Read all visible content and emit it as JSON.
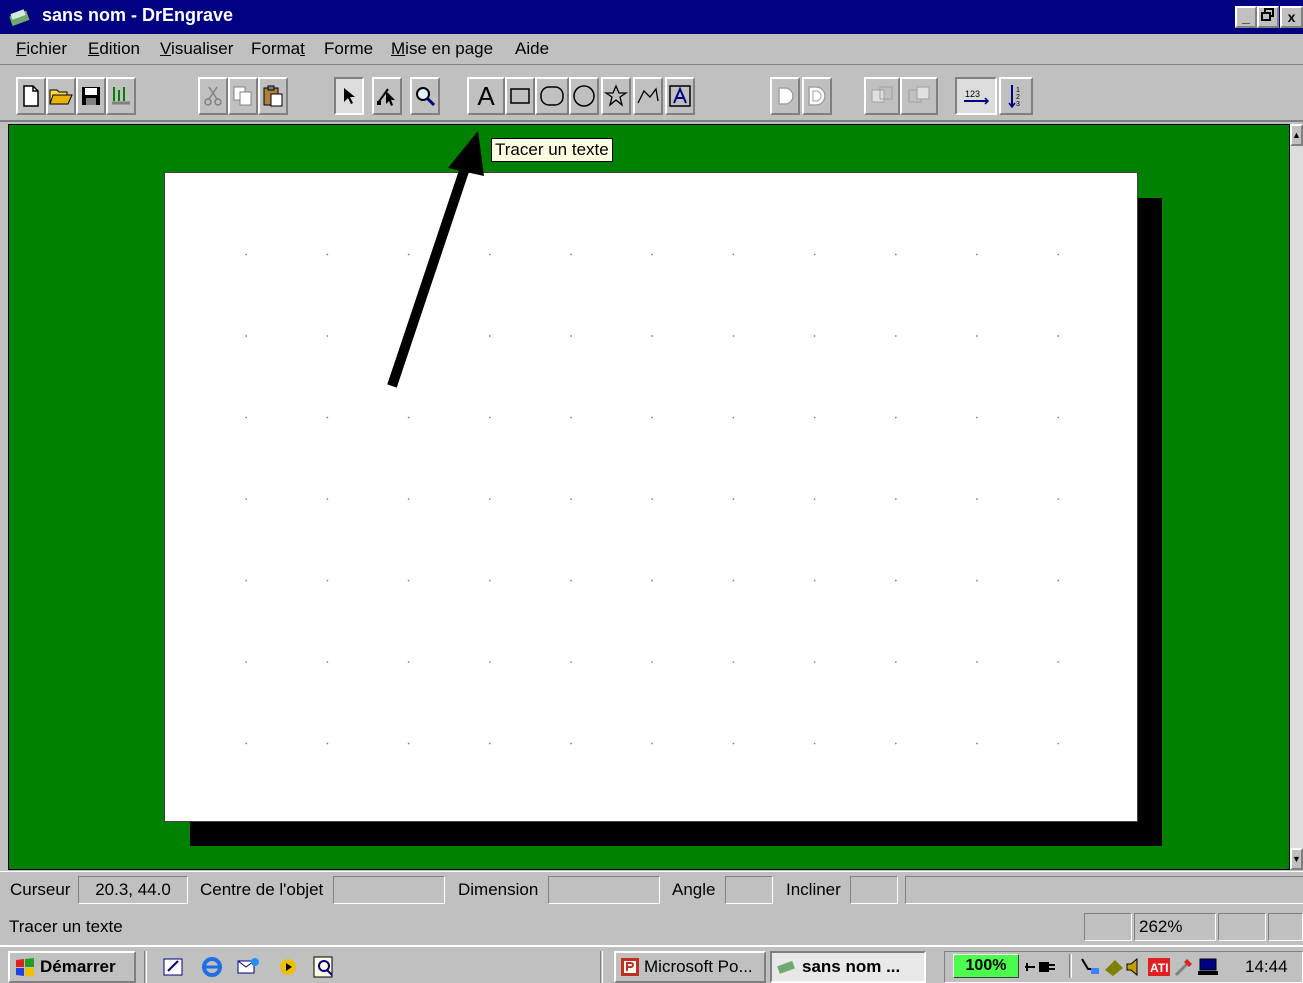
{
  "window": {
    "title": "sans nom - DrEngrave",
    "min_label": "_",
    "max_label": "□",
    "close_label": "x"
  },
  "menu": {
    "items": [
      {
        "label_first": "F",
        "label_rest": "ichier"
      },
      {
        "label_first": "E",
        "label_rest": "dition"
      },
      {
        "label_first": "V",
        "label_rest": "isualiser"
      },
      {
        "label_first": "Forma",
        "label_rest": "t",
        "underline_last": true
      },
      {
        "label_first": "F",
        "label_rest": "orme",
        "underline_second": true
      },
      {
        "label_first": "M",
        "label_rest": "ise en page"
      },
      {
        "label_first": "Ai",
        "label_rest": "de",
        "underline_second": true
      }
    ]
  },
  "toolbar": {
    "text_tool_glyph": "A"
  },
  "tooltip": {
    "text": "Tracer un texte"
  },
  "status": {
    "cursor_label": "Curseur",
    "cursor_value": "20.3, 44.0",
    "center_label": "Centre de l'objet",
    "center_value": "",
    "dimension_label": "Dimension",
    "dimension_value": "",
    "angle_label": "Angle",
    "angle_value": "",
    "incline_label": "Incliner",
    "incline_value": "",
    "help_text": "Tracer un texte",
    "zoom": "262%"
  },
  "taskbar": {
    "start_label": "Démarrer",
    "tasks": [
      {
        "label": "Microsoft Po..."
      },
      {
        "label": "sans nom ..."
      }
    ],
    "battery": "100%",
    "clock": "14:44"
  },
  "colors": {
    "titlebar": "#000080",
    "workspace": "#008000",
    "tooltip": "#ffffe1",
    "face": "#c0c0c0"
  }
}
